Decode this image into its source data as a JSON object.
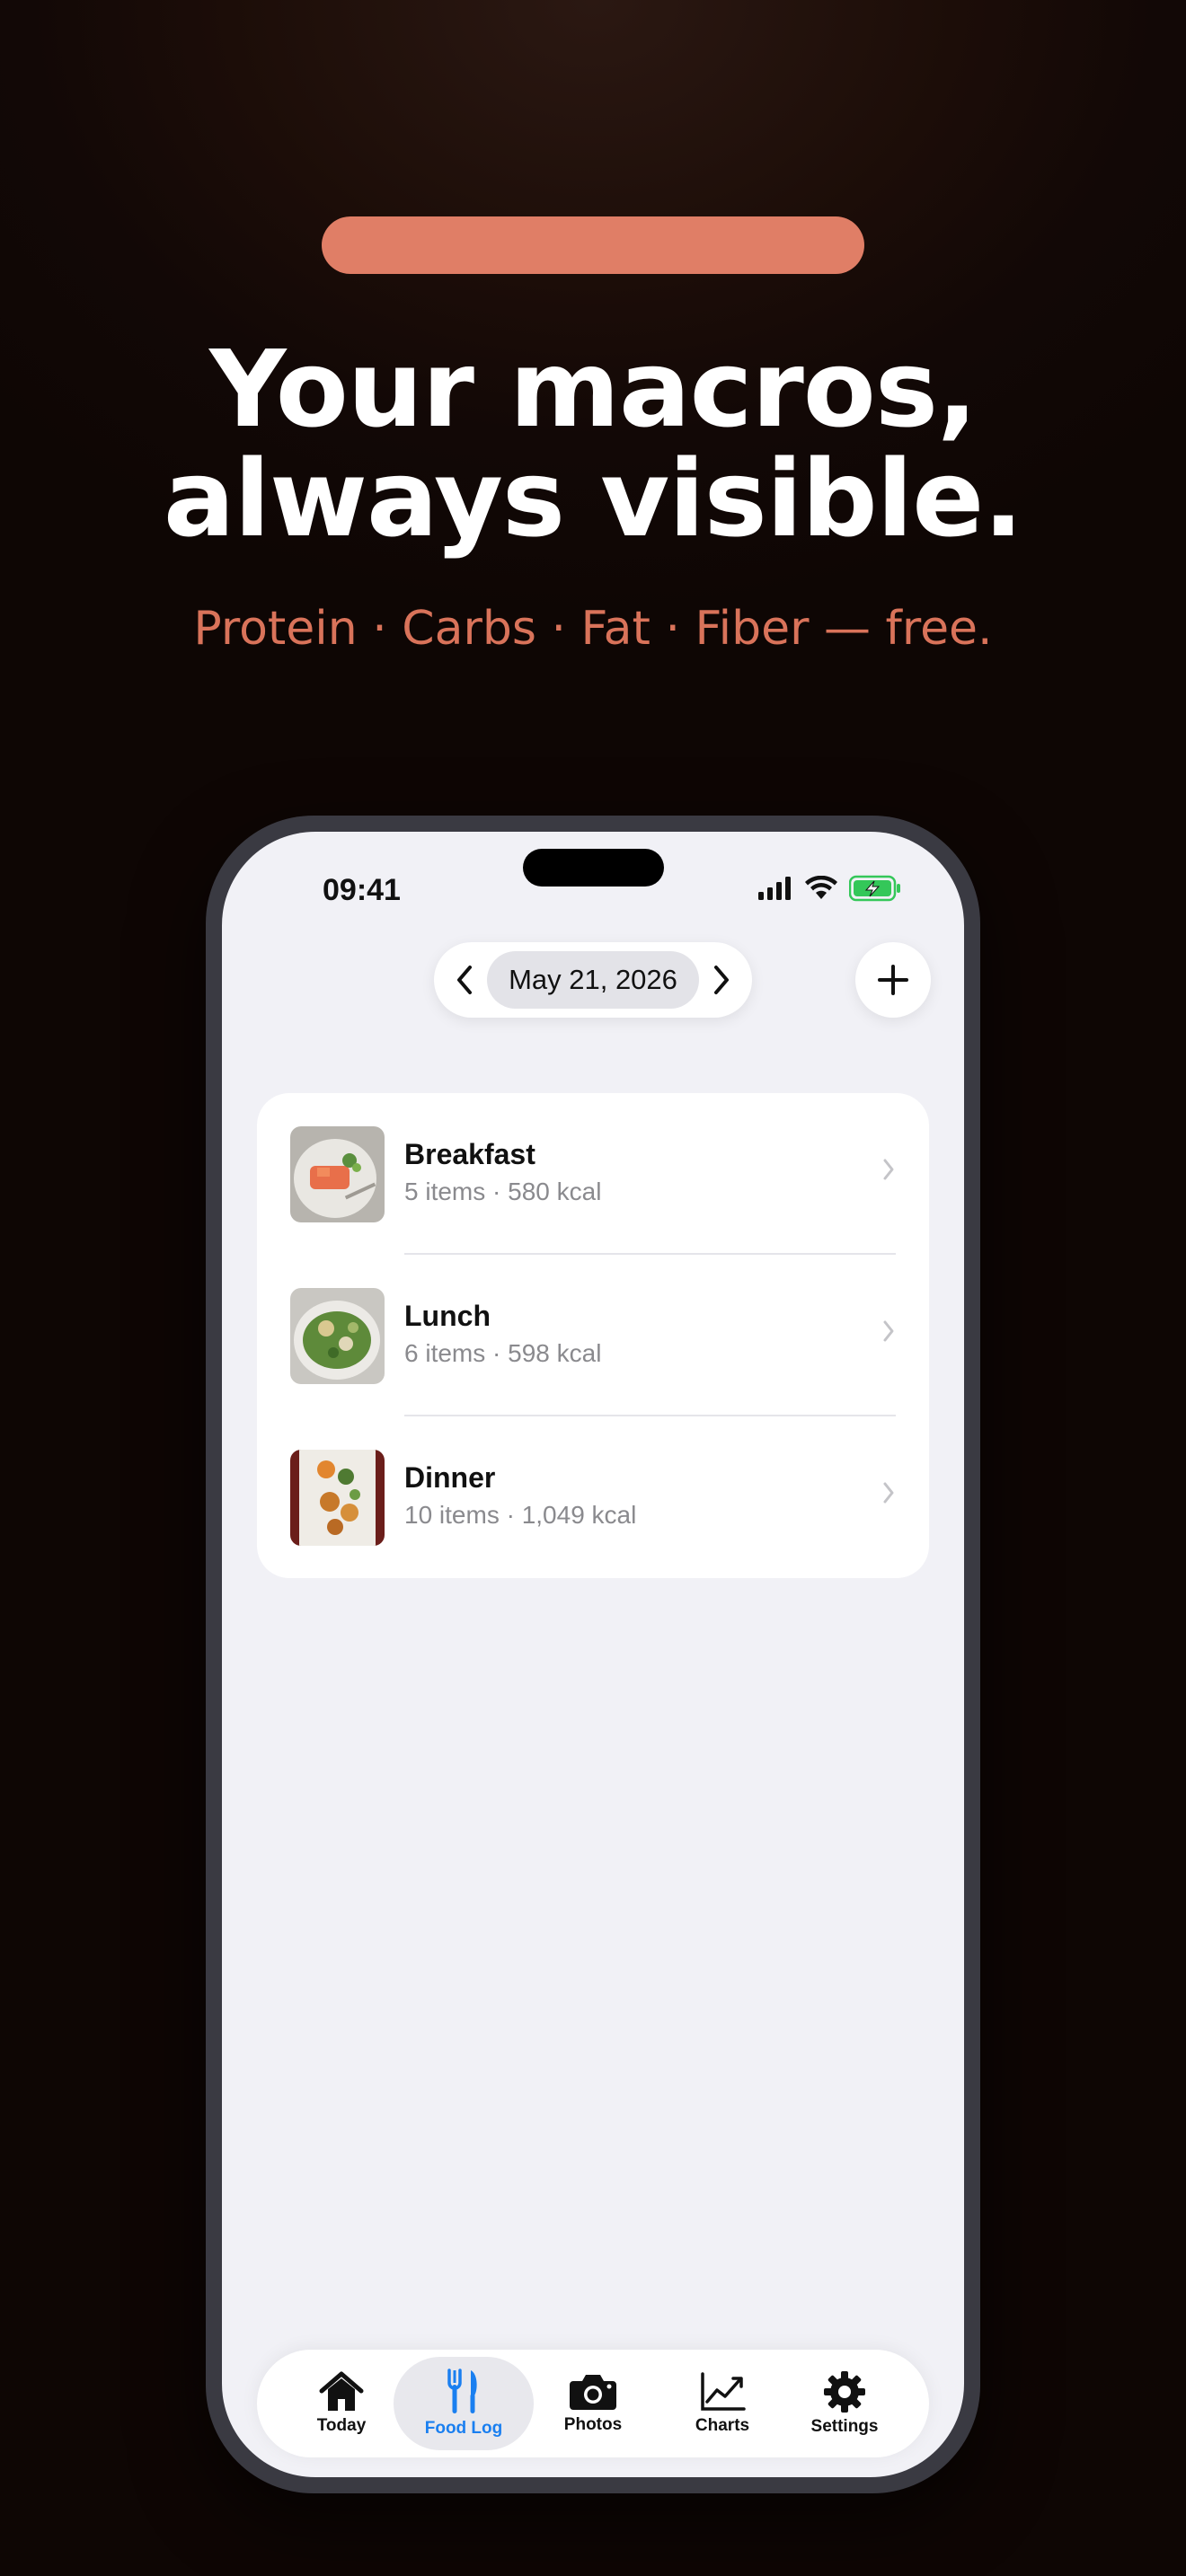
{
  "hero": {
    "headline_line1": "Your macros,",
    "headline_line2": "always visible.",
    "subheadline": "Protein · Carbs · Fat · Fiber — free."
  },
  "status_bar": {
    "time": "09:41",
    "icons": [
      "cellular-signal-icon",
      "wifi-icon",
      "battery-charging-icon"
    ]
  },
  "date_nav": {
    "date": "May 21, 2026",
    "prev_icon": "chevron-left-icon",
    "next_icon": "chevron-right-icon",
    "add_icon": "plus-icon"
  },
  "meals": [
    {
      "name": "Breakfast",
      "meta": "5 items · 580 kcal"
    },
    {
      "name": "Lunch",
      "meta": "6 items · 598 kcal"
    },
    {
      "name": "Dinner",
      "meta": "10 items · 1,049 kcal"
    }
  ],
  "tabs": [
    {
      "label": "Today",
      "icon": "house-icon",
      "active": false
    },
    {
      "label": "Food Log",
      "icon": "fork-knife-icon",
      "active": true
    },
    {
      "label": "Photos",
      "icon": "camera-icon",
      "active": false
    },
    {
      "label": "Charts",
      "icon": "chart-line-icon",
      "active": false
    },
    {
      "label": "Settings",
      "icon": "gear-icon",
      "active": false
    }
  ],
  "colors": {
    "accent": "#e07e66",
    "subhead": "#d9735a",
    "tab_active": "#1a7ff0",
    "battery": "#34c759"
  }
}
